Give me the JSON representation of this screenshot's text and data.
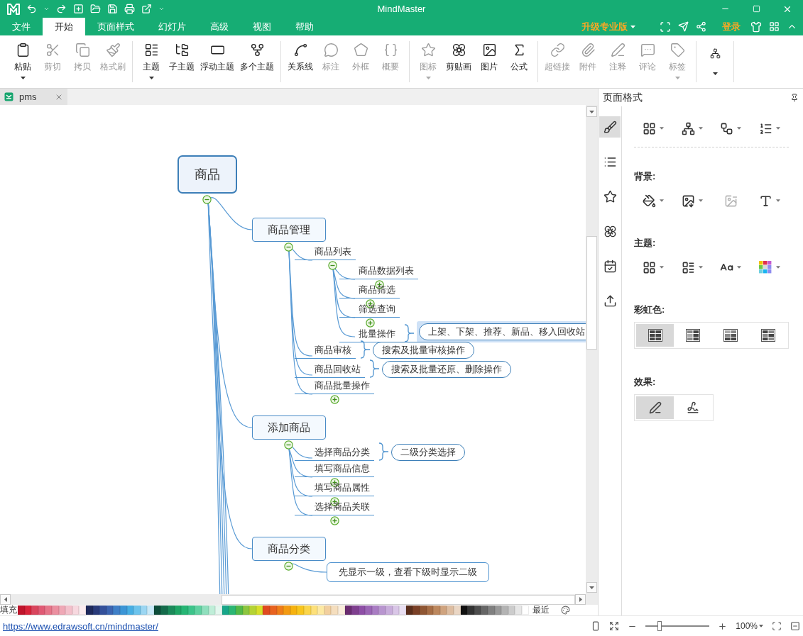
{
  "window": {
    "title": "MindMaster"
  },
  "menu": {
    "tabs": [
      {
        "label": "文件",
        "selected": false
      },
      {
        "label": "开始",
        "selected": true
      },
      {
        "label": "页面样式",
        "selected": false
      },
      {
        "label": "幻灯片",
        "selected": false
      },
      {
        "label": "高级",
        "selected": false
      },
      {
        "label": "视图",
        "selected": false
      },
      {
        "label": "帮助",
        "selected": false
      }
    ],
    "upgrade": "升级专业版",
    "login": "登录"
  },
  "ribbon": {
    "groups": [
      {
        "buttons": [
          {
            "label": "粘贴",
            "disabled": false,
            "dropdown": true
          },
          {
            "label": "剪切",
            "disabled": true,
            "dropdown": false
          },
          {
            "label": "拷贝",
            "disabled": true,
            "dropdown": false
          },
          {
            "label": "格式刷",
            "disabled": true,
            "dropdown": false
          }
        ]
      },
      {
        "buttons": [
          {
            "label": "主题",
            "disabled": false,
            "dropdown": true
          },
          {
            "label": "子主题",
            "disabled": false,
            "dropdown": false
          },
          {
            "label": "浮动主题",
            "disabled": false,
            "dropdown": false
          },
          {
            "label": "多个主题",
            "disabled": false,
            "dropdown": false
          }
        ]
      },
      {
        "buttons": [
          {
            "label": "关系线",
            "disabled": false,
            "dropdown": false
          },
          {
            "label": "标注",
            "disabled": true,
            "dropdown": false
          },
          {
            "label": "外框",
            "disabled": true,
            "dropdown": false
          },
          {
            "label": "概要",
            "disabled": true,
            "dropdown": false
          }
        ]
      },
      {
        "buttons": [
          {
            "label": "图标",
            "disabled": true,
            "dropdown": true
          },
          {
            "label": "剪贴画",
            "disabled": false,
            "dropdown": false
          },
          {
            "label": "图片",
            "disabled": false,
            "dropdown": false
          },
          {
            "label": "公式",
            "disabled": false,
            "dropdown": false
          }
        ]
      },
      {
        "buttons": [
          {
            "label": "超链接",
            "disabled": true,
            "dropdown": false
          },
          {
            "label": "附件",
            "disabled": true,
            "dropdown": false
          },
          {
            "label": "注释",
            "disabled": true,
            "dropdown": false
          },
          {
            "label": "评论",
            "disabled": true,
            "dropdown": false
          },
          {
            "label": "标签",
            "disabled": true,
            "dropdown": true
          }
        ]
      },
      {
        "buttons": [
          {
            "disabled": false,
            "dropdown": true
          }
        ]
      }
    ]
  },
  "document_tabs": [
    {
      "label": "pms",
      "selected": true
    }
  ],
  "mind_map": {
    "root": {
      "text": "商品",
      "children": [
        {
          "text": "商品管理",
          "children": [
            {
              "kind": "subtopic",
              "text": "商品列表",
              "collapsed": false,
              "children": [
                {
                  "kind": "subtopic",
                  "text": "商品数据列表",
                  "collapsed": true
                },
                {
                  "kind": "subtopic",
                  "text": "商品筛选",
                  "collapsed": true
                },
                {
                  "kind": "subtopic",
                  "text": "筛选查询",
                  "collapsed": true
                },
                {
                  "kind": "subtopic",
                  "text": "批量操作",
                  "collapsed": false,
                  "callout": {
                    "text": "上架、下架、推荐、新品、移入回收站",
                    "selected": true
                  }
                }
              ]
            },
            {
              "kind": "subtopic",
              "text": "商品审核",
              "collapsed": false,
              "callout": {
                "text": "搜索及批量审核操作",
                "selected": false
              }
            },
            {
              "kind": "subtopic",
              "text": "商品回收站",
              "collapsed": false,
              "callout": {
                "text": "搜索及批量还原、删除操作",
                "selected": false
              }
            },
            {
              "kind": "subtopic",
              "text": "商品批量操作",
              "collapsed": true
            }
          ]
        },
        {
          "text": "添加商品",
          "children": [
            {
              "kind": "subtopic",
              "text": "选择商品分类",
              "collapsed": false,
              "callout": {
                "text": "二级分类选择",
                "selected": false
              }
            },
            {
              "kind": "subtopic",
              "text": "填写商品信息",
              "collapsed": true
            },
            {
              "kind": "subtopic",
              "text": "填写商品属性",
              "collapsed": true
            },
            {
              "kind": "subtopic",
              "text": "选择商品关联",
              "collapsed": true
            }
          ]
        },
        {
          "text": "商品分类",
          "children": [
            {
              "kind": "note",
              "text": "先显示一级，查看下级时显示二级",
              "collapsed": false
            }
          ]
        }
      ]
    }
  },
  "palette": {
    "label": "填充",
    "recent_label": "最近",
    "swatches": [
      {
        "color": "#c0142b"
      },
      {
        "color": "#d9233a"
      },
      {
        "color": "#d9455d"
      },
      {
        "color": "#e05a74"
      },
      {
        "color": "#e67589"
      },
      {
        "color": "#eb8fa0"
      },
      {
        "color": "#efa8b6"
      },
      {
        "color": "#f3c0cb"
      },
      {
        "color": "#f7d8df"
      },
      {
        "color": "#fbecef"
      },
      {
        "color": "#1f2a5c"
      },
      {
        "color": "#2a3b7a"
      },
      {
        "color": "#34509a"
      },
      {
        "color": "#3c64b1"
      },
      {
        "color": "#3f7fc7"
      },
      {
        "color": "#3b95d6"
      },
      {
        "color": "#47aee3"
      },
      {
        "color": "#6cc3ec"
      },
      {
        "color": "#9bd6f2"
      },
      {
        "color": "#c9e9f8"
      },
      {
        "color": "#0d4d3a"
      },
      {
        "color": "#146b4b"
      },
      {
        "color": "#1b8a5a"
      },
      {
        "color": "#1fa565"
      },
      {
        "color": "#26b574"
      },
      {
        "color": "#3cc48a"
      },
      {
        "color": "#5fd1a0"
      },
      {
        "color": "#8fdfbd"
      },
      {
        "color": "#bfeed8"
      },
      {
        "color": "#e3f7ee"
      },
      {
        "color": "#17a689"
      },
      {
        "color": "#2bb673"
      },
      {
        "color": "#52b947"
      },
      {
        "color": "#8cc63f"
      },
      {
        "color": "#b5d334"
      },
      {
        "color": "#d7e02a"
      },
      {
        "color": "#e04a1f"
      },
      {
        "color": "#e8621f"
      },
      {
        "color": "#ef7d1a"
      },
      {
        "color": "#f39a12"
      },
      {
        "color": "#f6b20f"
      },
      {
        "color": "#f8c51d"
      },
      {
        "color": "#fbd54a"
      },
      {
        "color": "#fde07a"
      },
      {
        "color": "#fde9a3"
      },
      {
        "color": "#f2cf9e"
      },
      {
        "color": "#f5debe"
      },
      {
        "color": "#faeddb"
      },
      {
        "color": "#6a2c70"
      },
      {
        "color": "#7f3f8f"
      },
      {
        "color": "#8e4fa6"
      },
      {
        "color": "#9b65b5"
      },
      {
        "color": "#a97cc3"
      },
      {
        "color": "#b895cf"
      },
      {
        "color": "#c8addb"
      },
      {
        "color": "#d9c6e7"
      },
      {
        "color": "#e9dff2"
      },
      {
        "color": "#5a2e1c"
      },
      {
        "color": "#7a4027"
      },
      {
        "color": "#8f5633"
      },
      {
        "color": "#a66d45"
      },
      {
        "color": "#bc875d"
      },
      {
        "color": "#cfa37e"
      },
      {
        "color": "#ddbda1"
      },
      {
        "color": "#ead6c4"
      },
      {
        "color": "#111111"
      },
      {
        "color": "#333333"
      },
      {
        "color": "#4d4d4d"
      },
      {
        "color": "#666666"
      },
      {
        "color": "#808080"
      },
      {
        "color": "#999999"
      },
      {
        "color": "#b3b3b3"
      },
      {
        "color": "#cccccc"
      },
      {
        "color": "#e6e6e6"
      },
      {
        "color": "#ffffff"
      }
    ]
  },
  "right_panel": {
    "title": "页面格式",
    "side_tabs": [
      {
        "selected": true
      },
      {
        "selected": false
      },
      {
        "selected": false
      },
      {
        "selected": false
      },
      {
        "selected": false
      },
      {
        "selected": false
      }
    ],
    "top_tools": [
      {
        "dropdown": true
      },
      {
        "dropdown": true
      },
      {
        "dropdown": true
      },
      {
        "dropdown": true
      }
    ],
    "sections": [
      {
        "label": "背景:",
        "kind": "tools",
        "items": [
          {
            "disabled": false,
            "dropdown": true
          },
          {
            "disabled": false,
            "dropdown": true
          },
          {
            "disabled": true,
            "dropdown": false
          },
          {
            "disabled": false,
            "dropdown": true
          }
        ]
      },
      {
        "label": "主题:",
        "kind": "tools",
        "items": [
          {
            "disabled": false,
            "dropdown": true
          },
          {
            "disabled": false,
            "dropdown": true
          },
          {
            "disabled": false,
            "dropdown": true
          },
          {
            "disabled": false,
            "dropdown": true
          }
        ]
      },
      {
        "label": "彩虹色:",
        "kind": "segmented",
        "items": [
          {
            "selected": true
          },
          {
            "selected": false
          },
          {
            "selected": false
          },
          {
            "selected": false
          }
        ]
      },
      {
        "label": "效果:",
        "kind": "segmented",
        "items": [
          {
            "selected": true
          },
          {
            "selected": false
          }
        ]
      }
    ]
  },
  "status_bar": {
    "link": "https://www.edrawsoft.cn/mindmaster/",
    "zoom": {
      "level": 0.22,
      "reading": "100%"
    }
  }
}
